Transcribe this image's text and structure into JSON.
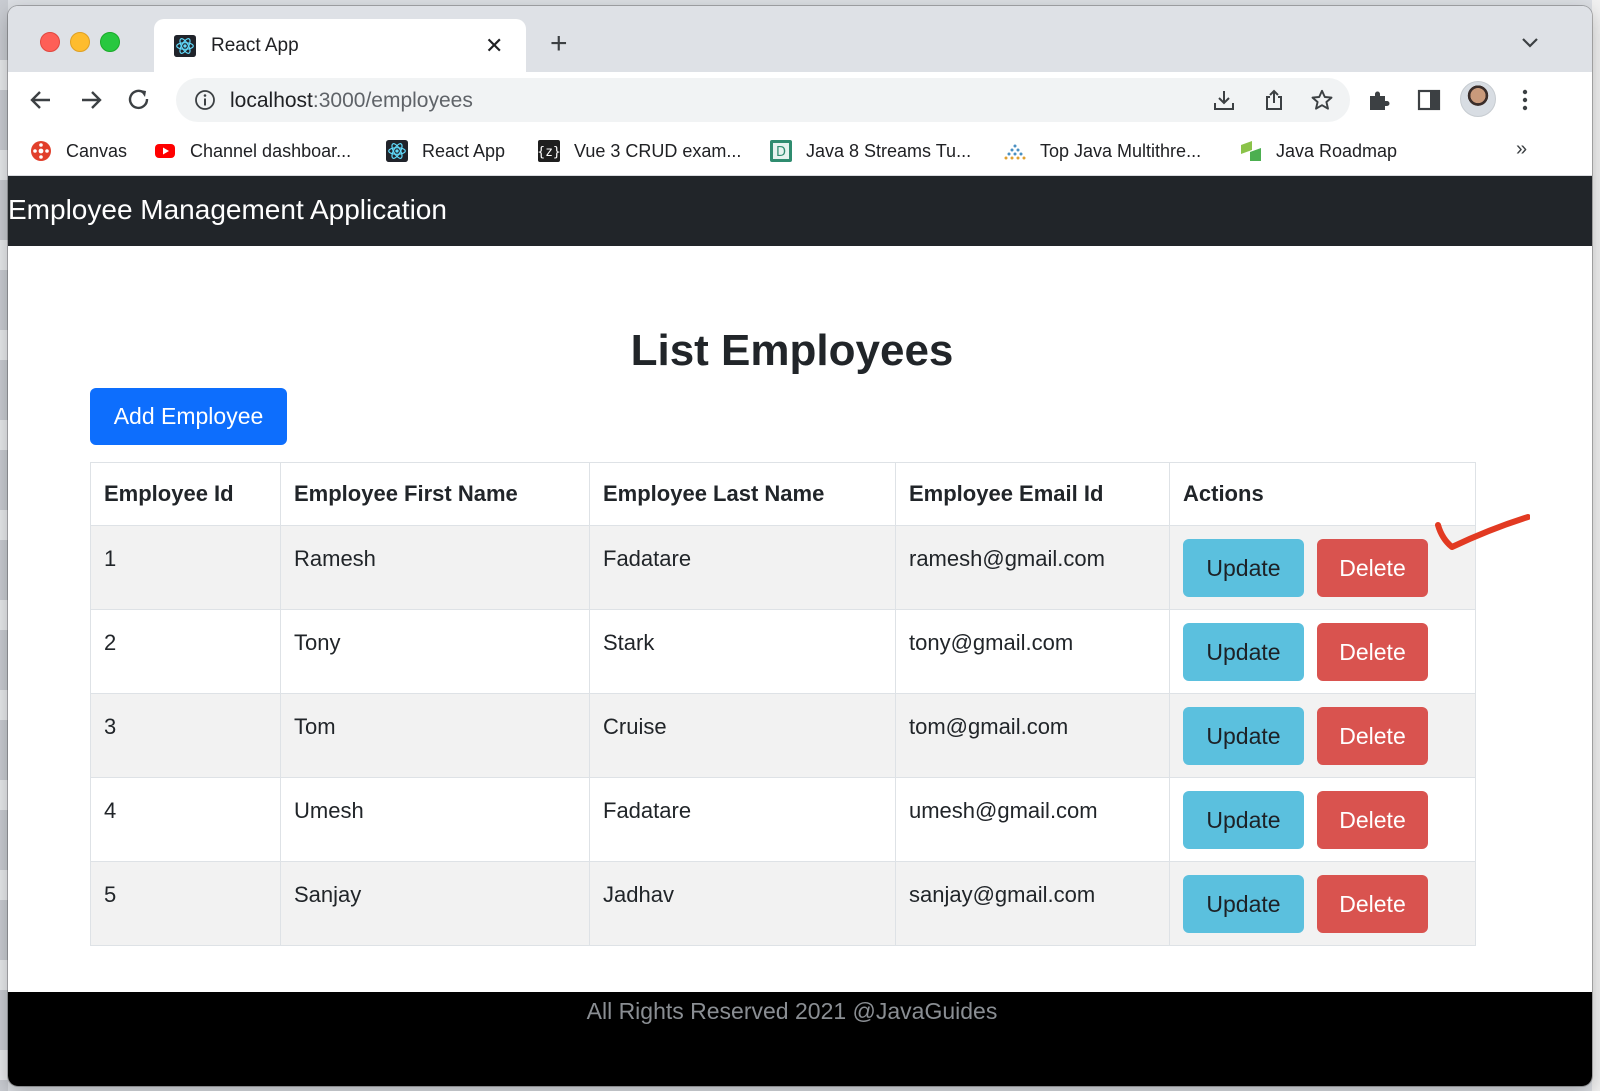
{
  "browser": {
    "tab": {
      "title": "React App",
      "close_glyph": "✕",
      "favicon": "react-icon"
    },
    "new_tab_glyph": "+",
    "tab_list_glyph": "⌄",
    "url": {
      "host": "localhost",
      "path": ":3000/employees"
    },
    "bookmarks": [
      {
        "label": "Canvas",
        "icon": "canvas-icon"
      },
      {
        "label": "Channel dashboar...",
        "icon": "youtube-icon"
      },
      {
        "label": "React App",
        "icon": "react-icon"
      },
      {
        "label": "Vue 3 CRUD exam...",
        "icon": "vue-z-icon"
      },
      {
        "label": "Java 8 Streams Tu...",
        "icon": "d-icon"
      },
      {
        "label": "Top Java Multithre...",
        "icon": "dots-icon"
      },
      {
        "label": "Java Roadmap",
        "icon": "roadmap-icon"
      }
    ],
    "bookmarks_more_glyph": "»"
  },
  "app": {
    "brand": "Employee Management Application",
    "heading": "List Employees",
    "add_button": "Add Employee",
    "table": {
      "headers": [
        "Employee Id",
        "Employee First Name",
        "Employee Last Name",
        "Employee Email Id",
        "Actions"
      ],
      "rows": [
        {
          "id": "1",
          "first": "Ramesh",
          "last": "Fadatare",
          "email": "ramesh@gmail.com"
        },
        {
          "id": "2",
          "first": "Tony",
          "last": "Stark",
          "email": "tony@gmail.com"
        },
        {
          "id": "3",
          "first": "Tom",
          "last": "Cruise",
          "email": "tom@gmail.com"
        },
        {
          "id": "4",
          "first": "Umesh",
          "last": "Fadatare",
          "email": "umesh@gmail.com"
        },
        {
          "id": "5",
          "first": "Sanjay",
          "last": "Jadhav",
          "email": "sanjay@gmail.com"
        }
      ],
      "update_label": "Update",
      "delete_label": "Delete"
    },
    "footer": "All Rights Reserved 2021 @JavaGuides"
  },
  "colors": {
    "navbar": "#212529",
    "primary": "#0d6efd",
    "info": "#5bc0de",
    "danger": "#d9534f",
    "annotation": "#e23a22"
  }
}
